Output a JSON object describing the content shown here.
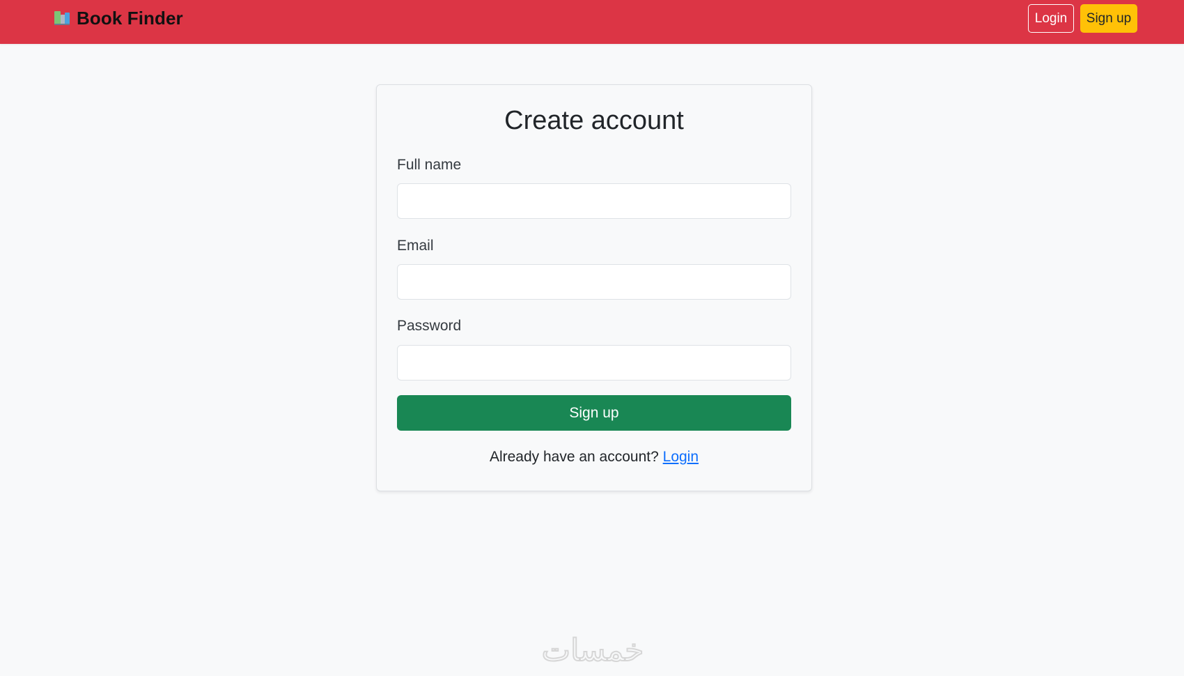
{
  "navbar": {
    "brand": {
      "icon": "books-icon",
      "title": "Book Finder"
    },
    "login_label": "Login",
    "signup_label": "Sign up",
    "colors": {
      "background": "#dc3545",
      "signup_button": "#ffc107"
    }
  },
  "form": {
    "title": "Create account",
    "fields": [
      {
        "label": "Full name",
        "value": "",
        "placeholder": ""
      },
      {
        "label": "Email",
        "value": "",
        "placeholder": ""
      },
      {
        "label": "Password",
        "value": "",
        "placeholder": ""
      }
    ],
    "submit_label": "Sign up",
    "submit_color": "#198754",
    "footer_text": "Already have an account?",
    "footer_link": "Login",
    "link_color": "#0d6efd"
  },
  "watermark": {
    "text": "خمسات"
  }
}
